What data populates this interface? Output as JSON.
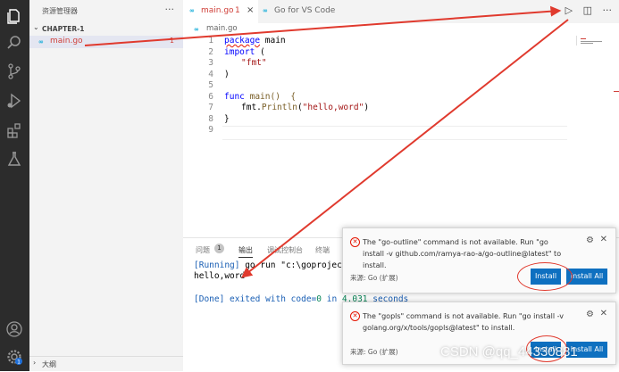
{
  "sidebar": {
    "title": "资源管理器",
    "more": "···",
    "folder": "CHAPTER-1",
    "file": {
      "icon_text": "∞",
      "name": "main.go",
      "badge": "1"
    },
    "outline": "大纲"
  },
  "tabs": [
    {
      "icon_text": "∞",
      "label": "main.go",
      "badge": "1",
      "close": "×"
    },
    {
      "icon_text": "∞",
      "label": "Go for VS Code"
    }
  ],
  "breadcrumb": {
    "icon_text": "∞",
    "label": "main.go"
  },
  "editor": {
    "lines": [
      "1",
      "2",
      "3",
      "4",
      "5",
      "6",
      "7",
      "8",
      "9"
    ],
    "code": {
      "l1_kw": "package",
      "l1_rest": " main",
      "l2_kw": "import",
      "l2_rest": " (",
      "l3_str": "\"fmt\"",
      "l4": ")",
      "l6_kw": "func",
      "l6_rest": " main()  {",
      "l7_pre": "fmt.",
      "l7_fn": "Println",
      "l7_open": "(",
      "l7_str": "\"hello,word\"",
      "l7_close": ")",
      "l8": "}"
    }
  },
  "editor_actions": {
    "run": "▷",
    "split": "◫",
    "more": "···"
  },
  "panel": {
    "tabs": [
      "问题",
      "输出",
      "调试控制台",
      "终端"
    ],
    "problem_count": "1",
    "output": {
      "running_tag": "[Running]",
      "running_cmd": " go run \"c:\\goproject\\sr",
      "hello": "hello,word",
      "done_prefix": "[Done] exited with code=",
      "done_code": "0",
      "done_mid": " in ",
      "done_secs": "4.031",
      "done_suffix": " seconds"
    }
  },
  "notifications": [
    {
      "message": "The \"go-outline\" command is not available. Run \"go install -v github.com/ramya-rao-a/go-outline@latest\" to install.",
      "source": "来源: Go (扩展)",
      "buttons": [
        "Install",
        "Install All"
      ]
    },
    {
      "message": "The \"gopls\" command is not available. Run \"go install -v golang.org/x/tools/gopls@latest\" to install.",
      "source": "来源: Go (扩展)",
      "buttons": [
        "Install",
        "Install All"
      ]
    }
  ],
  "watermark": "CSDN @qq_44330881",
  "colors": {
    "arrow": "#e03a2e",
    "accent": "#0e70c0",
    "error": "#e51400"
  }
}
